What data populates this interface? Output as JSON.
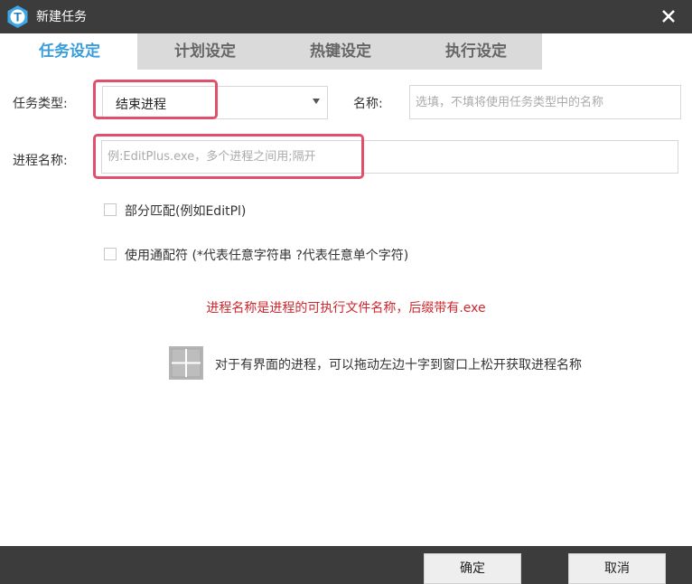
{
  "window": {
    "title": "新建任务",
    "logo_letter": "T",
    "close_glyph": "×"
  },
  "tabs": [
    {
      "label": "任务设定",
      "active": true
    },
    {
      "label": "计划设定",
      "active": false
    },
    {
      "label": "热键设定",
      "active": false
    },
    {
      "label": "执行设定",
      "active": false
    }
  ],
  "form": {
    "task_type_label": "任务类型:",
    "task_type_value": "结束进程",
    "name_label": "名称:",
    "name_placeholder": "选填，不填将使用任务类型中的名称",
    "process_label": "进程名称:",
    "process_placeholder": "例:EditPlus.exe，多个进程之间用;隔开",
    "partial_match_label": "部分匹配(例如EditPl)",
    "partial_match_checked": false,
    "wildcard_label": "使用通配符 (*代表任意字符串 ?代表任意单个字符)",
    "wildcard_checked": false
  },
  "note": "进程名称是进程的可执行文件名称，后缀带有.exe",
  "hint": "对于有界面的进程，可以拖动左边十字到窗口上松开获取进程名称",
  "footer": {
    "ok_label": "确定",
    "cancel_label": "取消"
  },
  "colors": {
    "accent": "#3a9ede",
    "highlight": "#e0506a",
    "note": "#d0262c",
    "titlebar": "#3c3c3c"
  }
}
